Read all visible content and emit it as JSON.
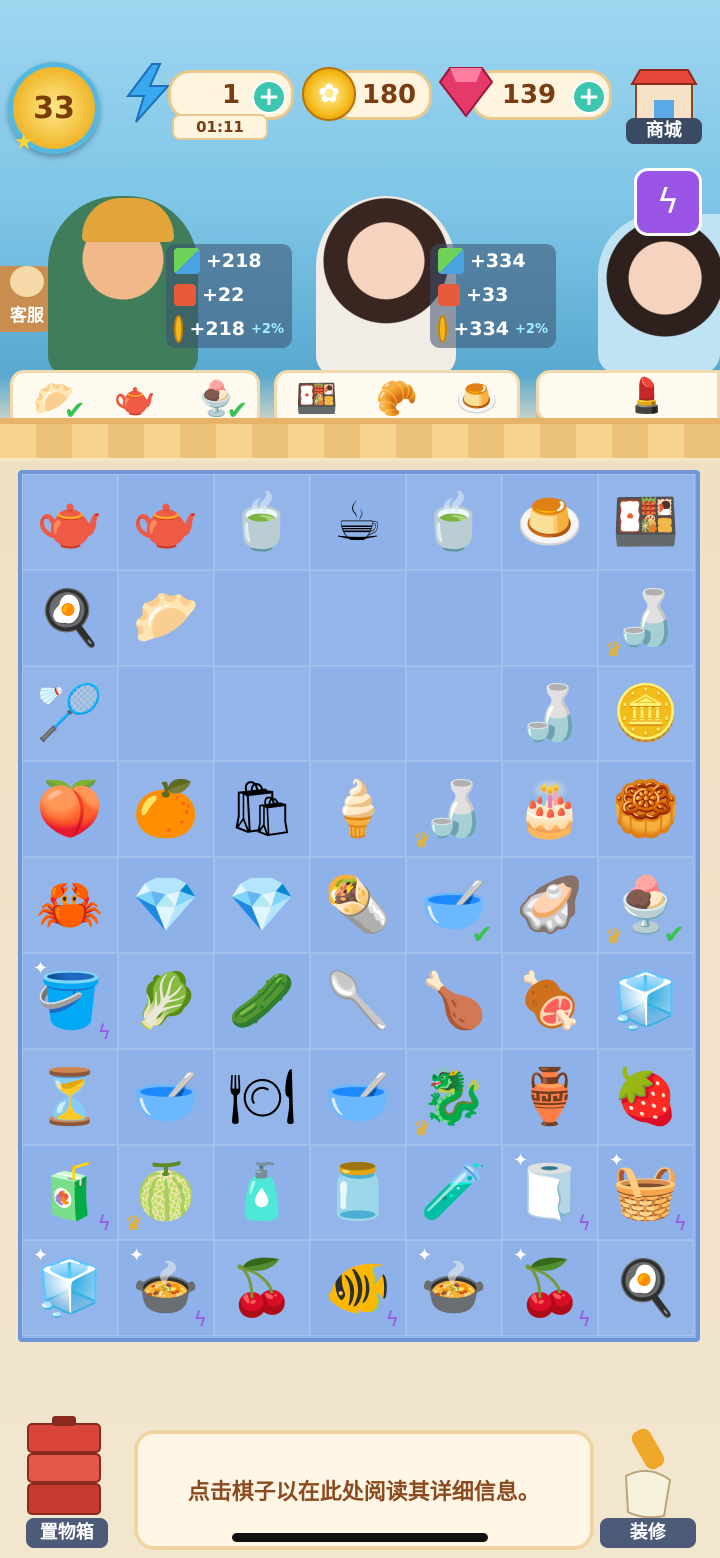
{
  "hud": {
    "level": "33",
    "energy": {
      "value": "1",
      "timer": "01:11"
    },
    "coins": "180",
    "gems": "139",
    "shop_label": "商城"
  },
  "support_label": "客服",
  "customers": [
    {
      "rewards": [
        {
          "icon": "box-icon",
          "text": "+218"
        },
        {
          "icon": "ticket-icon",
          "text": "+22"
        },
        {
          "icon": "coin-icon",
          "text": "+218",
          "bonus": "+2%"
        }
      ],
      "orders": [
        {
          "icon": "🥟",
          "done": true
        },
        {
          "icon": "🫖",
          "done": false
        },
        {
          "icon": "🍨",
          "done": true
        }
      ]
    },
    {
      "rewards": [
        {
          "icon": "box-icon",
          "text": "+334"
        },
        {
          "icon": "ticket-icon",
          "text": "+33"
        },
        {
          "icon": "coin-icon",
          "text": "+334",
          "bonus": "+2%"
        }
      ],
      "orders": [
        {
          "icon": "🍱",
          "done": false
        },
        {
          "icon": "🥐",
          "done": false
        },
        {
          "icon": "🍮",
          "done": false
        }
      ]
    },
    {
      "rewards": [],
      "orders": [
        {
          "icon": "💄",
          "done": false
        }
      ]
    }
  ],
  "board": [
    [
      {
        "n": "teapot-set",
        "e": "🫖"
      },
      {
        "n": "teapot",
        "e": "🫖"
      },
      {
        "n": "lemon-tea",
        "e": "🍵"
      },
      {
        "n": "tea-cup",
        "e": "☕"
      },
      {
        "n": "covered-bowl",
        "e": "🍵"
      },
      {
        "n": "egg-custard",
        "e": "🍮"
      },
      {
        "n": "bento-box",
        "e": "🍱"
      }
    ],
    [
      {
        "n": "frying-pan",
        "e": "🍳"
      },
      {
        "n": "shrimp-dumplings",
        "e": "🥟"
      },
      {
        "n": "empty",
        "e": ""
      },
      {
        "n": "empty",
        "e": ""
      },
      {
        "n": "empty",
        "e": ""
      },
      {
        "n": "empty",
        "e": ""
      },
      {
        "n": "sake-set",
        "e": "🍶",
        "crown": true
      }
    ],
    [
      {
        "n": "strainer",
        "e": "🏸"
      },
      {
        "n": "empty",
        "e": ""
      },
      {
        "n": "empty",
        "e": ""
      },
      {
        "n": "empty",
        "e": ""
      },
      {
        "n": "empty",
        "e": ""
      },
      {
        "n": "sake-bottle",
        "e": "🍶"
      },
      {
        "n": "gold-coin",
        "e": "🪙"
      }
    ],
    [
      {
        "n": "peach",
        "e": "🍑"
      },
      {
        "n": "orange",
        "e": "🍊"
      },
      {
        "n": "paper-bag",
        "e": "🛍"
      },
      {
        "n": "ice-cream-cone",
        "e": "🍦"
      },
      {
        "n": "sake-set",
        "e": "🍶",
        "crown": true
      },
      {
        "n": "chocolate-cake",
        "e": "🎂"
      },
      {
        "n": "dim-sum-steamer",
        "e": "🥮"
      }
    ],
    [
      {
        "n": "crabs",
        "e": "🦀"
      },
      {
        "n": "small-ruby",
        "e": "💎"
      },
      {
        "n": "ruby-pile",
        "e": "💎"
      },
      {
        "n": "spring-rolls",
        "e": "🌯"
      },
      {
        "n": "dumpling-soup",
        "e": "🥣",
        "check": true
      },
      {
        "n": "oysters",
        "e": "🦪"
      },
      {
        "n": "dessert-basket",
        "e": "🍨",
        "crown": true,
        "check": true
      }
    ],
    [
      {
        "n": "sand-bucket",
        "e": "🪣",
        "bolt": true,
        "sparkle": true
      },
      {
        "n": "cabbage",
        "e": "🥬"
      },
      {
        "n": "cucumber",
        "e": "🥒"
      },
      {
        "n": "spatula",
        "e": "🥄"
      },
      {
        "n": "roast-chicken",
        "e": "🍗"
      },
      {
        "n": "roast-duck",
        "e": "🍖"
      },
      {
        "n": "ice-cubes",
        "e": "🧊"
      }
    ],
    [
      {
        "n": "hourglass",
        "e": "⏳"
      },
      {
        "n": "flower-bowl",
        "e": "🥣"
      },
      {
        "n": "flower-plate",
        "e": "🍽"
      },
      {
        "n": "footed-bowl",
        "e": "🥣"
      },
      {
        "n": "dragon-fruit",
        "e": "🐉",
        "crown": true
      },
      {
        "n": "green-pitcher",
        "e": "🏺"
      },
      {
        "n": "strawberry",
        "e": "🍓"
      }
    ],
    [
      {
        "n": "juicer",
        "e": "🧃",
        "bolt": true
      },
      {
        "n": "lime",
        "e": "🍈",
        "crown": true
      },
      {
        "n": "lotion-bottle",
        "e": "🧴"
      },
      {
        "n": "cream-jar",
        "e": "🫙"
      },
      {
        "n": "perfume-bottle",
        "e": "🧪"
      },
      {
        "n": "cosmetic-pad",
        "e": "🧻",
        "bolt": true,
        "sparkle": true
      },
      {
        "n": "vegetable-basket",
        "e": "🧺",
        "bolt": true,
        "sparkle": true
      }
    ],
    [
      {
        "n": "mini-fridge",
        "e": "🧊",
        "sparkle": true
      },
      {
        "n": "soup-pot",
        "e": "🍲",
        "bolt": true,
        "sparkle": true
      },
      {
        "n": "cherry-bowl",
        "e": "🍒"
      },
      {
        "n": "fish-bowl",
        "e": "🐠",
        "bolt": true
      },
      {
        "n": "soup-pot",
        "e": "🍲",
        "sparkle": true
      },
      {
        "n": "cherry-pan",
        "e": "🍒",
        "bolt": true,
        "sparkle": true
      },
      {
        "n": "sieve",
        "e": "🍳"
      }
    ]
  ],
  "bottom": {
    "storage_label": "置物箱",
    "info_text": "点击棋子以在此处阅读其详细信息。",
    "decorate_label": "装修"
  }
}
